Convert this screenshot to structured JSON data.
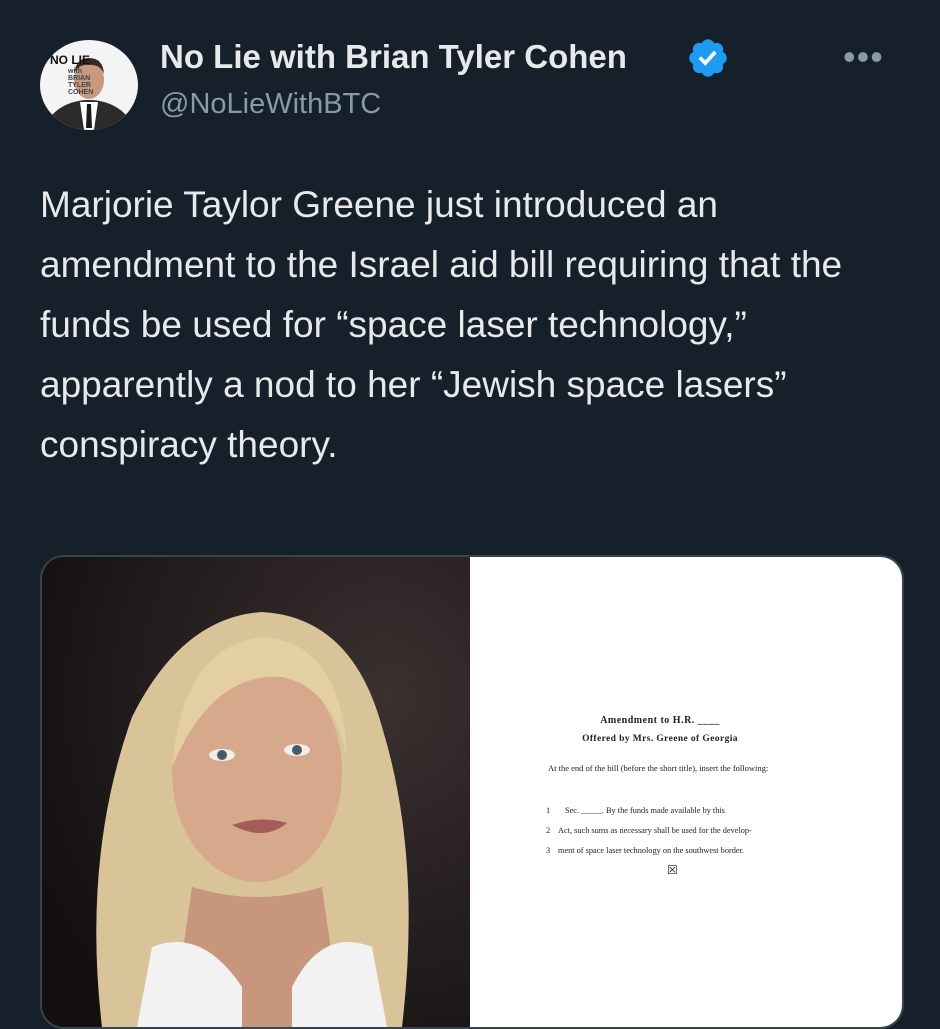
{
  "author": {
    "name": "No Lie with Brian Tyler Cohen",
    "handle": "@NoLieWithBTC",
    "avatar_logo": "NO LIE",
    "avatar_sub": [
      "with",
      "BRIAN",
      "TYLER",
      "COHEN"
    ],
    "verified_icon": "verified-badge-icon",
    "verified_color": "#1d9bf0"
  },
  "more_label": "•••",
  "tweet": {
    "text": "Marjorie Taylor Greene just introduced an amendment to the Israel aid bill requiring that the funds be used for “space laser technology,” apparently a nod to her “Jewish space lasers” conspiracy theory."
  },
  "document": {
    "title": "Amendment to H.R. ____",
    "subtitle": "Offered by Mrs. Greene of Georgia",
    "intro": "At the end of the bill (before the short title), insert the following:",
    "lines": [
      {
        "num": "1",
        "text": "Sec. _____. By the funds made available by this"
      },
      {
        "num": "2",
        "text": "Act, such sums as necessary shall be used for the develop-"
      },
      {
        "num": "3",
        "text": "ment of space laser technology on the southwest border."
      }
    ],
    "checkbox": "☒"
  }
}
